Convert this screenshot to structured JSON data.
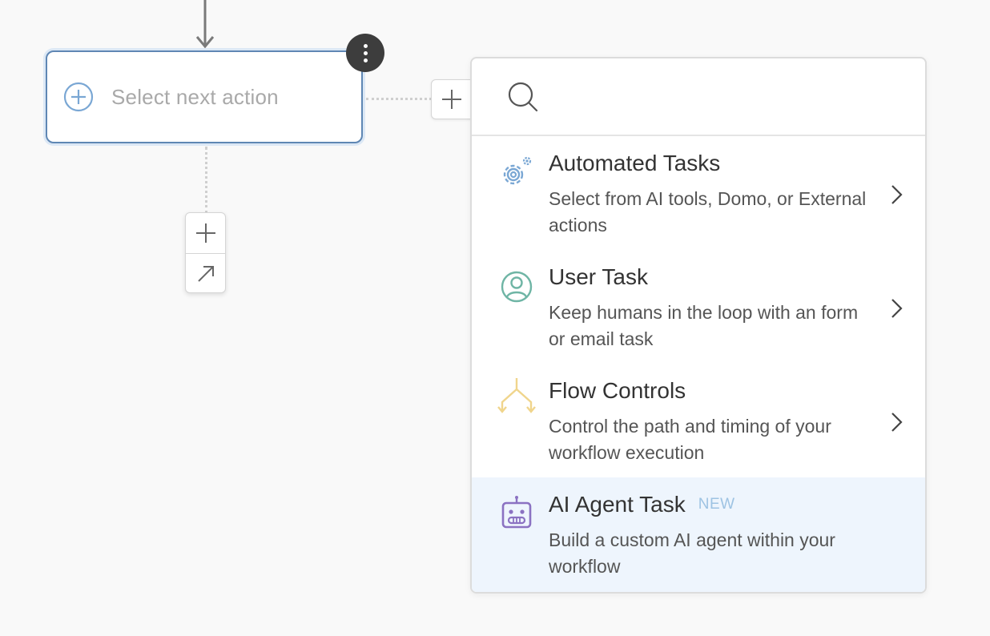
{
  "node": {
    "label": "Select next action"
  },
  "search": {
    "value": "",
    "placeholder": ""
  },
  "menu": {
    "items": [
      {
        "title": "Automated Tasks",
        "badge": "",
        "description": "Select from AI tools, Domo, or External actions",
        "icon": "gear-icon"
      },
      {
        "title": "User Task",
        "badge": "",
        "description": "Keep humans in the loop with an form or email task",
        "icon": "user-icon"
      },
      {
        "title": "Flow Controls",
        "badge": "",
        "description": "Control the path and timing of your workflow execution",
        "icon": "branch-icon"
      },
      {
        "title": "AI Agent Task",
        "badge": "NEW",
        "description": "Build a custom AI agent within your workflow",
        "icon": "robot-icon"
      }
    ]
  },
  "colors": {
    "node_border": "#5f87b4",
    "gear": "#7aa7d4",
    "user": "#6fb5a5",
    "branch": "#f0d58c",
    "robot": "#8b72c2",
    "highlight": "#eef5fd"
  }
}
